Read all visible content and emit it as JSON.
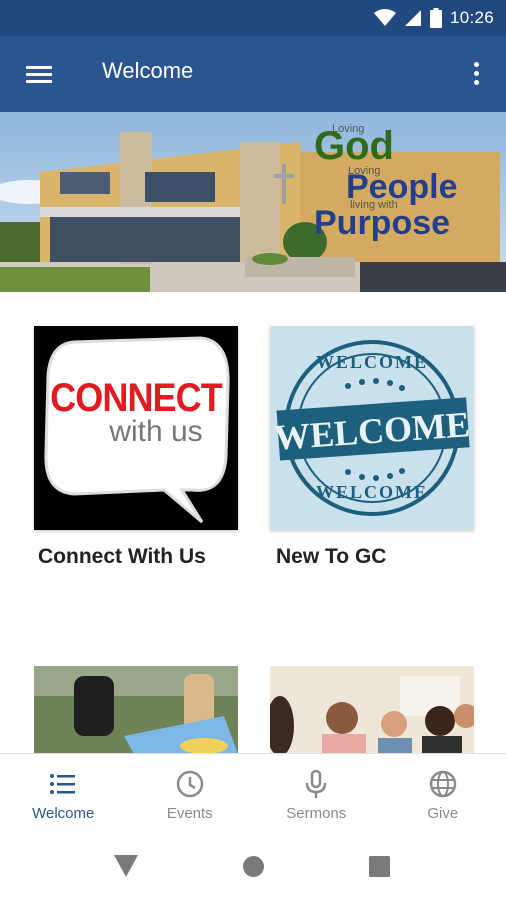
{
  "status_bar": {
    "time": "10:26"
  },
  "app_bar": {
    "title": "Welcome"
  },
  "hero": {
    "line1_small": "Loving",
    "line1_big": "God",
    "line2_small": "Loving",
    "line2_big": "People",
    "line3_small": "living with",
    "line3_big": "Purpose"
  },
  "tiles": [
    {
      "label": "Connect With Us",
      "art_line1": "CONNECT",
      "art_line2": "with us"
    },
    {
      "label": "New To GC",
      "art_top": "WELCOME",
      "art_center": "WELCOME",
      "art_bottom": "WELCOME"
    }
  ],
  "bottom_nav": {
    "items": [
      {
        "label": "Welcome",
        "icon": "list-icon",
        "active": true
      },
      {
        "label": "Events",
        "icon": "clock-icon",
        "active": false
      },
      {
        "label": "Sermons",
        "icon": "microphone-icon",
        "active": false
      },
      {
        "label": "Give",
        "icon": "globe-icon",
        "active": false
      }
    ]
  },
  "colors": {
    "status_bar": "#22497f",
    "app_bar": "#2b5591",
    "accent": "#2b5591",
    "inactive": "#8a8a8a"
  }
}
